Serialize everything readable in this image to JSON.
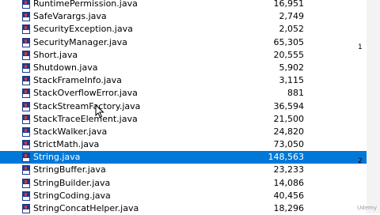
{
  "files": [
    {
      "name": "RuntimePermission.java",
      "size": "16,951"
    },
    {
      "name": "SafeVarargs.java",
      "size": "2,749"
    },
    {
      "name": "SecurityException.java",
      "size": "2,052"
    },
    {
      "name": "SecurityManager.java",
      "size": "65,305"
    },
    {
      "name": "Short.java",
      "size": "20,555"
    },
    {
      "name": "Shutdown.java",
      "size": "5,902"
    },
    {
      "name": "StackFrameInfo.java",
      "size": "3,115"
    },
    {
      "name": "StackOverflowError.java",
      "size": "881"
    },
    {
      "name": "StackStreamFactory.java",
      "size": "36,594"
    },
    {
      "name": "StackTraceElement.java",
      "size": "21,500"
    },
    {
      "name": "StackWalker.java",
      "size": "24,820"
    },
    {
      "name": "StrictMath.java",
      "size": "73,050"
    },
    {
      "name": "String.java",
      "size": "148,563",
      "selected": true
    },
    {
      "name": "StringBuffer.java",
      "size": "23,233"
    },
    {
      "name": "StringBuilder.java",
      "size": "14,086"
    },
    {
      "name": "StringCoding.java",
      "size": "40,456"
    },
    {
      "name": "StringConcatHelper.java",
      "size": "18,296"
    }
  ],
  "file_icon": "java-file-icon",
  "colors": {
    "selection": "#0078d7",
    "icon_blue": "#1e3a8c",
    "icon_red": "#d33a2c"
  },
  "watermark": "Udemy"
}
